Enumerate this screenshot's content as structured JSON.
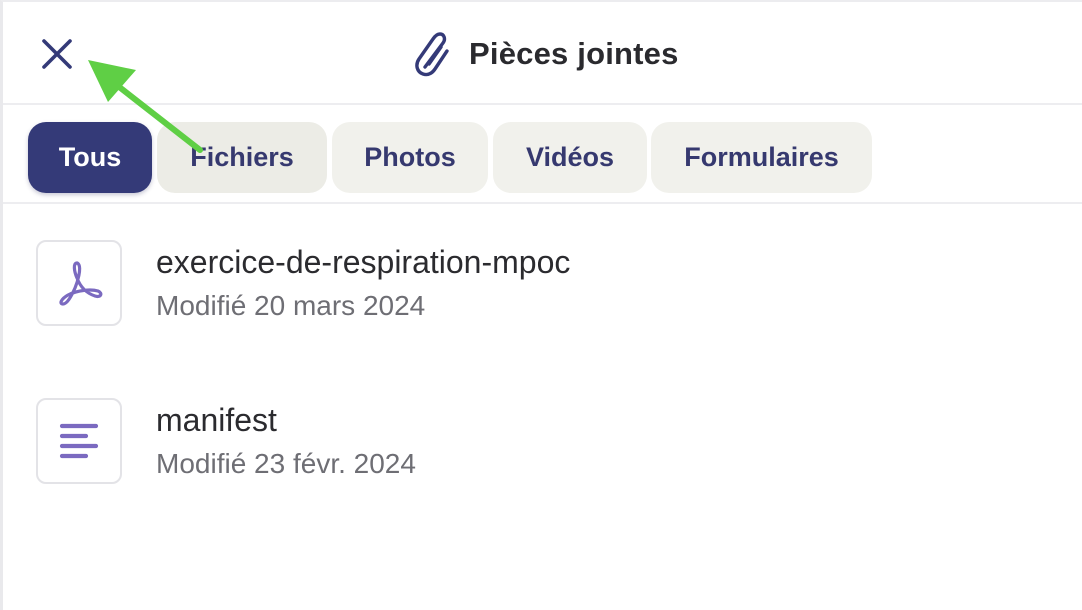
{
  "header": {
    "title": "Pièces jointes",
    "close_icon": "close-icon",
    "title_icon": "paperclip-icon"
  },
  "tabs": [
    {
      "label": "Tous",
      "active": true
    },
    {
      "label": "Fichiers",
      "active": false
    },
    {
      "label": "Photos",
      "active": false
    },
    {
      "label": "Vidéos",
      "active": false
    },
    {
      "label": "Formulaires",
      "active": false
    }
  ],
  "files": [
    {
      "name": "exercice-de-respiration-mpoc",
      "modified": "Modifié 20 mars 2024",
      "icon": "pdf-icon"
    },
    {
      "name": "manifest",
      "modified": "Modifié 23 févr. 2024",
      "icon": "text-file-icon"
    }
  ],
  "colors": {
    "accent": "#343a78",
    "icon_purple": "#7b6ac0",
    "annotation_arrow": "#5fcf45"
  }
}
